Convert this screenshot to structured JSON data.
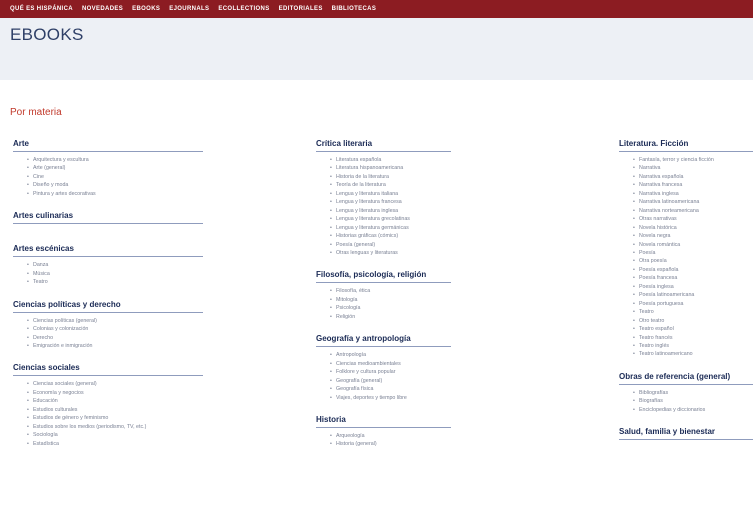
{
  "nav": [
    "QUÉ ES HISPÁNICA",
    "NOVEDADES",
    "EBOOKS",
    "EJOURNALS",
    "ECOLLECTIONS",
    "EDITORIALES",
    "BIBLIOTECAS"
  ],
  "page_title": "EBOOKS",
  "section_title": "Por materia",
  "columns": [
    [
      {
        "title": "Arte",
        "items": [
          "Arquitectura y escultura",
          "Arte (general)",
          "Cine",
          "Diseño y moda",
          "Pintura y artes decorativas"
        ]
      },
      {
        "title": "Artes culinarias",
        "items": []
      },
      {
        "title": "Artes escénicas",
        "items": [
          "Danza",
          "Música",
          "Teatro"
        ]
      },
      {
        "title": "Ciencias políticas y derecho",
        "items": [
          "Ciencias políticas (general)",
          "Colonias y colonización",
          "Derecho",
          "Emigración e inmigración"
        ]
      },
      {
        "title": "Ciencias sociales",
        "items": [
          "Ciencias sociales (general)",
          "Economía y negocios",
          "Educación",
          "Estudios culturales",
          "Estudios de género y feminismo",
          "Estudios sobre los medios (periodismo, TV, etc.)",
          "Sociología",
          "Estadística"
        ]
      }
    ],
    [
      {
        "title": "Crítica literaria",
        "items": [
          "Literatura española",
          "Literatura hispanoamericana",
          "Historia de la literatura",
          "Teoría de la literatura",
          "Lengua y literatura italiana",
          "Lengua y literatura francesa",
          "Lengua y literatura inglesa",
          "Lengua y literatura grecolatinas",
          "Lengua y literatura germánicas",
          "Historias gráficas (cómics)",
          "Poesía (general)",
          "Otras lenguas y literaturas"
        ]
      },
      {
        "title": "Filosofía, psicología, religión",
        "items": [
          "Filosofía, ética",
          "Mitología",
          "Psicología",
          "Religión"
        ]
      },
      {
        "title": "Geografía y antropología",
        "items": [
          "Antropología",
          "Ciencias medioambientales",
          "Folklore y cultura popular",
          "Geografía (general)",
          "Geografía física",
          "Viajes, deportes y tiempo libre"
        ]
      },
      {
        "title": "Historia",
        "items": [
          "Arqueología",
          "Historia (general)"
        ]
      }
    ],
    [
      {
        "title": "Literatura. Ficción",
        "items": [
          "Fantasía, terror y ciencia ficción",
          "Narrativa",
          "Narrativa española",
          "Narrativa francesa",
          "Narrativa inglesa",
          "Narrativa latinoamericana",
          "Narrativa norteamericana",
          "Otras narrativas",
          "Novela histórica",
          "Novela negra",
          "Novela romántica",
          "Poesía",
          "Otra poesía",
          "Poesía española",
          "Poesía francesa",
          "Poesía inglesa",
          "Poesía latinoamericana",
          "Poesía portuguesa",
          "Teatro",
          "Otro teatro",
          "Teatro español",
          "Teatro francés",
          "Teatro inglés",
          "Teatro latinoamericano"
        ]
      },
      {
        "title": "Obras de referencia (general)",
        "items": [
          "Bibliografías",
          "Biografías",
          "Enciclopedias y diccionarios"
        ]
      },
      {
        "title": "Salud, familia y bienestar",
        "items": []
      }
    ]
  ]
}
